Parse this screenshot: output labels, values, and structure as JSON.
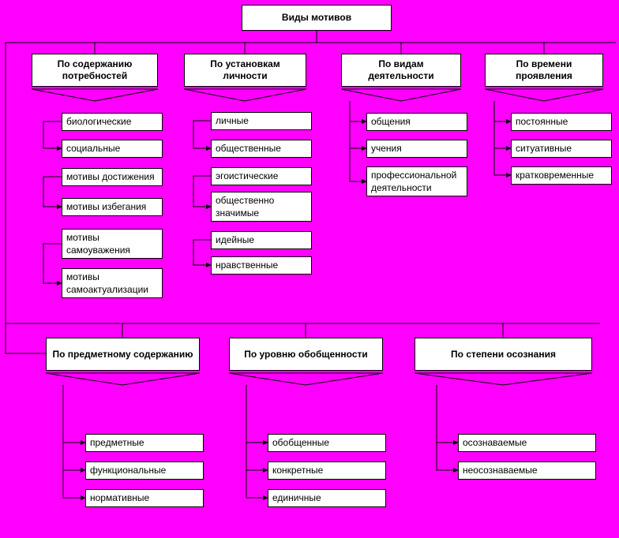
{
  "root": "Виды мотивов",
  "row1": {
    "c1": {
      "title": "По содержанию потребностей",
      "items": [
        "биологические",
        "социальные",
        "мотивы достижения",
        "мотивы избегания",
        "мотивы самоуважения",
        "мотивы самоактуализации"
      ]
    },
    "c2": {
      "title": "По установкам личности",
      "items": [
        "личные",
        "общественные",
        "эгоистические",
        "общественно значимые",
        "идейные",
        "нравственные"
      ]
    },
    "c3": {
      "title": "По видам деятельности",
      "items": [
        "общения",
        "учения",
        "профессиональной деятельности"
      ]
    },
    "c4": {
      "title": "По времени проявления",
      "items": [
        "постоянные",
        "ситуативные",
        "кратковременные"
      ]
    }
  },
  "row2": {
    "c5": {
      "title": "По предметному содержанию",
      "items": [
        "предметные",
        "функциональные",
        "нормативные"
      ]
    },
    "c6": {
      "title": "По уровню обобщенности",
      "items": [
        "обобщенные",
        "конкретные",
        "единичные"
      ]
    },
    "c7": {
      "title": "По степени осознания",
      "items": [
        "осознаваемые",
        "неосознаваемые"
      ]
    }
  }
}
